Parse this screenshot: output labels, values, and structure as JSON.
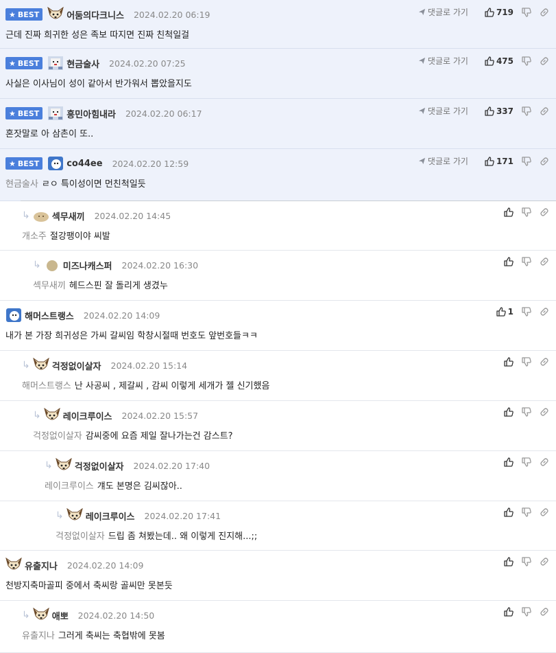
{
  "labels": {
    "best": "BEST",
    "goto": "댓글로 가기"
  },
  "comments": [
    {
      "best": true,
      "nick": "어둠의다크니스",
      "date": "2024.02.20 06:19",
      "text": "근데 진짜 희귀한 성은 족보 따지면 진짜 친척일걸",
      "mention": "",
      "likes": "719",
      "indent": 0,
      "avatar": "dog"
    },
    {
      "best": true,
      "nick": "현금술사",
      "date": "2024.02.20 07:25",
      "text": "사실은 이사님이 성이 같아서 반가워서 뽑았을지도",
      "mention": "",
      "likes": "475",
      "indent": 0,
      "avatar": "pixel"
    },
    {
      "best": true,
      "nick": "흥민아힘내라",
      "date": "2024.02.20 06:17",
      "text": "혼잣말로 아 삼촌이 또..",
      "mention": "",
      "likes": "337",
      "indent": 0,
      "avatar": "pixel"
    },
    {
      "best": true,
      "nick": "co44ee",
      "date": "2024.02.20 12:59",
      "text": "ㄹㅇ 특이성이면 먼친척일듯",
      "mention": "현금술사",
      "likes": "171",
      "indent": 0,
      "avatar": "blue"
    },
    {
      "best": false,
      "nick": "섹무새끼",
      "date": "2024.02.20 14:45",
      "text": "절강팽이야 씨발",
      "mention": "개소주",
      "likes": "",
      "indent": 1,
      "avatar": "bun"
    },
    {
      "best": false,
      "nick": "미즈나캐스퍼",
      "date": "2024.02.20 16:30",
      "text": "헤드스핀 잘 돌리게 생겼누",
      "mention": "섹무새끼",
      "likes": "",
      "indent": 2,
      "avatar": "circle"
    },
    {
      "best": false,
      "nick": "해머스트랭스",
      "date": "2024.02.20 14:09",
      "text": "내가 본 가장 희귀성은 가씨 갈씨임 학창시절때 번호도 앞번호들ㅋㅋ",
      "mention": "",
      "likes": "1",
      "indent": 0,
      "avatar": "blue"
    },
    {
      "best": false,
      "nick": "걱정없이살자",
      "date": "2024.02.20 15:14",
      "text": "난 사공씨 , 제갈씨 , 감씨 이렇게 세개가 젤 신기했음",
      "mention": "해머스트랭스",
      "likes": "",
      "indent": 1,
      "avatar": "dog"
    },
    {
      "best": false,
      "nick": "레이크루이스",
      "date": "2024.02.20 15:57",
      "text": "감씨중에 요즘 제일 잘나가는건 감스트?",
      "mention": "걱정없이살자",
      "likes": "",
      "indent": 2,
      "avatar": "dog"
    },
    {
      "best": false,
      "nick": "걱정없이살자",
      "date": "2024.02.20 17:40",
      "text": "걔도 본명은 김씨잖아..",
      "mention": "레이크루이스",
      "likes": "",
      "indent": 3,
      "avatar": "dog"
    },
    {
      "best": false,
      "nick": "레이크루이스",
      "date": "2024.02.20 17:41",
      "text": "드립 좀 쳐봤는데.. 왜 이렇게 진지해...;;",
      "mention": "걱정없이살자",
      "likes": "",
      "indent": 4,
      "avatar": "dog"
    },
    {
      "best": false,
      "nick": "유출지나",
      "date": "2024.02.20 14:09",
      "text": "천방지축마골피 중에서 축씨랑 골씨만 못본듯",
      "mention": "",
      "likes": "",
      "indent": 0,
      "avatar": "dog"
    },
    {
      "best": false,
      "nick": "애뽀",
      "date": "2024.02.20 14:50",
      "text": "그러게 축씨는 축협밖에 못봄",
      "mention": "유출지나",
      "likes": "",
      "indent": 1,
      "avatar": "dog"
    }
  ]
}
